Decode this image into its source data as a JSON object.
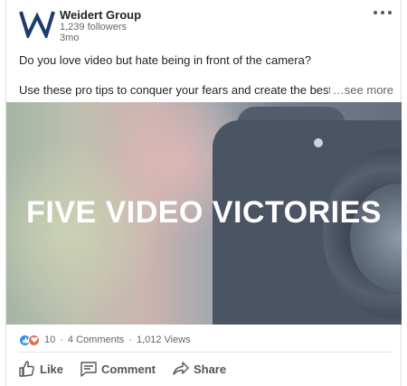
{
  "post": {
    "author": {
      "name": "Weidert Group",
      "followers": "1,239 followers",
      "time": "3mo",
      "logo_letter": "W"
    },
    "text": {
      "line1": "Do you love video but hate being in front of the camera?",
      "line2": "Use these pro tips to conquer your fears and create the best video",
      "see_more": "…see more"
    },
    "media": {
      "title": "FIVE VIDEO VICTORIES"
    },
    "social": {
      "reactions": "10",
      "comments": "4 Comments",
      "views": "1,012 Views",
      "separator": "·"
    },
    "actions": {
      "like": "Like",
      "comment": "Comment",
      "share": "Share"
    }
  },
  "colors": {
    "brand": "#1b3b6f",
    "like_reaction": "#378fe9",
    "love_reaction": "#df704d"
  }
}
